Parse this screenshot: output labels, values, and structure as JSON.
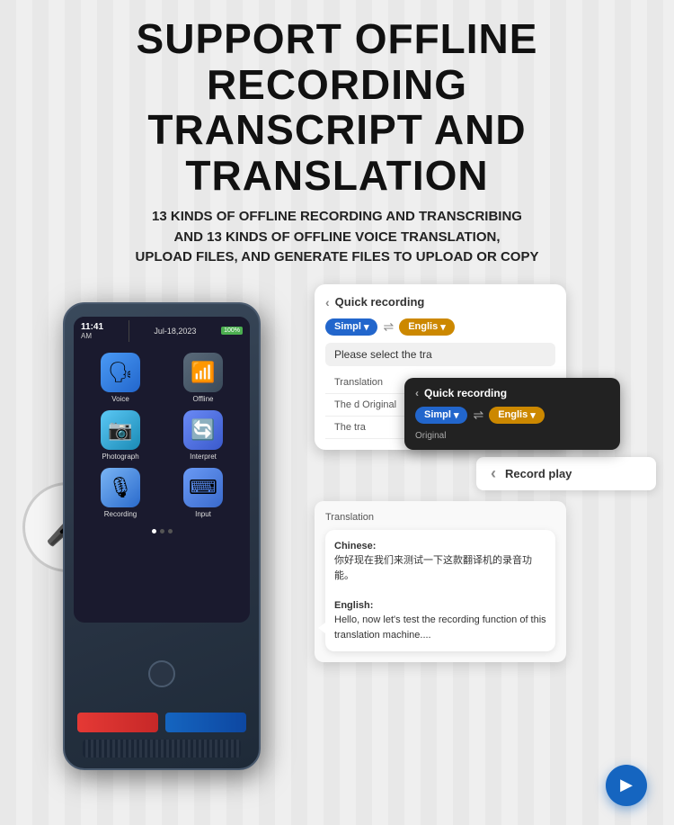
{
  "header": {
    "main_title_line1": "SUPPORT OFFLINE RECORDING",
    "main_title_line2": "TRANSCRIPT AND TRANSLATION",
    "subtitle_line1": "13 KINDS OF OFFLINE RECORDING AND TRANSCRIBING",
    "subtitle_line2": "AND 13 KINDS OF OFFLINE VOICE TRANSLATION,",
    "subtitle_line3": "UPLOAD FILES, AND GENERATE FILES TO UPLOAD OR COPY"
  },
  "device": {
    "time": "11:41",
    "period": "AM",
    "date": "Jul-18,2023",
    "battery": "100%",
    "apps": [
      {
        "label": "Voice",
        "icon": "🗣"
      },
      {
        "label": "Offline",
        "icon": "📶"
      },
      {
        "label": "Photograph",
        "icon": "📷"
      },
      {
        "label": "Interpret",
        "icon": "🔄"
      },
      {
        "label": "Recording",
        "icon": "🎙"
      },
      {
        "label": "Input",
        "icon": "⌨"
      }
    ]
  },
  "cards": {
    "card1": {
      "title": "Quick recording",
      "lang_from": "Simpl",
      "lang_to": "Englis",
      "select_text": "Please select the tra",
      "menu1": "Translation",
      "menu2": "The d Original",
      "menu3": "The tra"
    },
    "card2": {
      "title": "Quick recording",
      "lang_from": "Simpl",
      "lang_to": "Englis",
      "original_label": "Original"
    },
    "card3": {
      "title": "Record play",
      "back_icon": "‹"
    },
    "card4": {
      "translation_label": "Translation",
      "chinese_label": "Chinese:",
      "chinese_text": "你好现在我们来测试一下这款翻译机的录音功能。",
      "english_label": "English:",
      "english_text": "Hello, now let's test the recording function of this translation machine...."
    }
  },
  "icons": {
    "back": "‹",
    "play": "▶",
    "mic": "🎤",
    "arrow_right": "→"
  },
  "colors": {
    "accent_blue": "#1565c0",
    "lang_blue": "#2266cc",
    "lang_gold": "#cc8800",
    "dark_card": "#222222"
  }
}
